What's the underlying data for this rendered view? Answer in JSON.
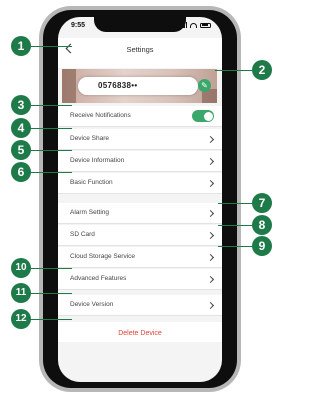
{
  "status_bar": {
    "time": "9:55"
  },
  "header": {
    "title": "Settings"
  },
  "device": {
    "name": "0576838••"
  },
  "colors": {
    "accent": "#3aa86b",
    "danger": "#e0423a",
    "callout": "#1f7a4a"
  },
  "rows": [
    {
      "label": "Receive Notifications",
      "control": "toggle",
      "toggle_on": true
    },
    {
      "label": "Device Share"
    },
    {
      "label": "Device Information"
    },
    {
      "label": "Basic Function"
    },
    {
      "label": "Alarm Setting"
    },
    {
      "label": "SD Card"
    },
    {
      "label": "Cloud Storage Service"
    },
    {
      "label": "Advanced Features"
    },
    {
      "label": "Device Version"
    }
  ],
  "delete_label": "Delete Device",
  "callouts": [
    "1",
    "2",
    "3",
    "4",
    "5",
    "6",
    "7",
    "8",
    "9",
    "10",
    "11",
    "12"
  ]
}
